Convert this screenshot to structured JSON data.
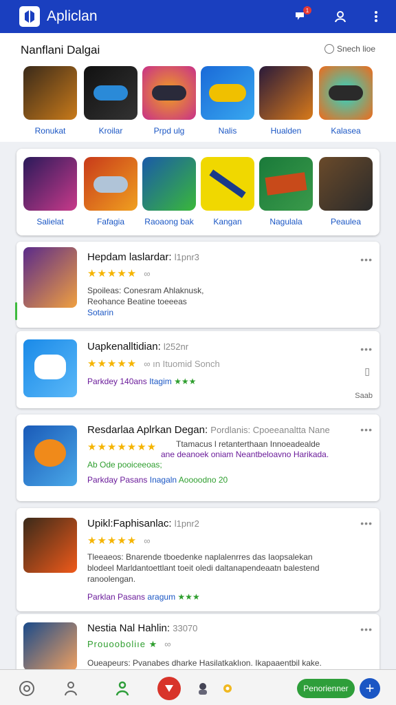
{
  "app": {
    "title": "Aplicl­an",
    "notification_count": "1"
  },
  "section": {
    "title": "Nanflani Dalgai",
    "see_all": "Snech lioe"
  },
  "row1": [
    {
      "label": "Ronukat",
      "icon": "game-art-icon",
      "colors": [
        "#3a2a1a",
        "#c87a1a"
      ]
    },
    {
      "label": "Kroilar",
      "icon": "gamepad-icon",
      "colors": [
        "#111111",
        "#2a8ad8"
      ]
    },
    {
      "label": "Prpd ulg",
      "icon": "gamepad-icon",
      "colors": [
        "#c8308a",
        "#f0a020"
      ]
    },
    {
      "label": "Nalis",
      "icon": "gamepad-icon",
      "colors": [
        "#1a6ad8",
        "#f0c000"
      ]
    },
    {
      "label": "Hualden",
      "icon": "game-art-icon",
      "colors": [
        "#2a1a3a",
        "#d87a1a"
      ]
    },
    {
      "label": "Kalasea",
      "icon": "gamepad-icon",
      "colors": [
        "#f06a1a",
        "#2ad8c8"
      ]
    }
  ],
  "row2": [
    {
      "label": "Salielat",
      "icon": "character-icon",
      "colors": [
        "#2a1a5a",
        "#c83a8a"
      ]
    },
    {
      "label": "Fafagia",
      "icon": "gamepad-icon",
      "colors": [
        "#c83a1a",
        "#f0a020"
      ]
    },
    {
      "label": "Raoaong bak",
      "icon": "character-icon",
      "colors": [
        "#1a5aa8",
        "#3ab83a"
      ]
    },
    {
      "label": "Kangan",
      "icon": "controller-icon",
      "colors": [
        "#f0d800",
        "#1a3a8a"
      ]
    },
    {
      "label": "Nagulala",
      "icon": "game-art-icon",
      "colors": [
        "#1a7a3a",
        "#c84a1a"
      ]
    },
    {
      "label": "Peaulea",
      "icon": "game-art-icon",
      "colors": [
        "#6a4a2a",
        "#2a2a2a"
      ]
    }
  ],
  "cards": [
    {
      "title": "Hepdam laslardar:",
      "meta": "l1pnr3",
      "stars": "★★★★★",
      "link": "∞",
      "lines": [
        "Spoileas: Conesram  Ahlaknusk,",
        "Reohance Beatine toeeeas"
      ],
      "tag": "Sotarin",
      "colors": [
        "#5a2a8a",
        "#f0a040"
      ]
    },
    {
      "title": "Uapkenalltidian:",
      "meta": "l252nr",
      "stars": "★★★★★",
      "link": "∞ ın Ituomid Sonch",
      "lines": [
        "Parkdey 140ans",
        "Itagim",
        "★★★"
      ],
      "side": "Saab",
      "colors": [
        "#1a8ae8",
        "#2a2a2a"
      ]
    },
    {
      "title": "Resdarlaa Aplrkan Degan:",
      "meta": "Pordlanis: Cpoeeanaltta Nane",
      "stars": "★★★★★★★",
      "link": "Ttamacus l retanterthaan Innoeadealde",
      "lines": [
        "ane deanoek oniam Neantbeloavno Harikada.",
        "Ab Ode pooiceeoas;",
        "Parkday Pasans",
        "Inagaln",
        "Aoooodno 20"
      ],
      "colors": [
        "#1a5ab8",
        "#f08a1a"
      ]
    },
    {
      "title": "Upikl:Faphisanlac:",
      "meta": "l1pnr2",
      "stars": "★★★★★",
      "link": "∞",
      "lines": [
        "Tleeaeos: Bnarende tboedenke naplalenrres das Iaopsalekan",
        "blodeel Marldantoettlant toeit oledi daltanapendeaatn balestend",
        "ranoolengan."
      ],
      "extra": [
        "Parklan Pasans",
        "aragum",
        "★★★"
      ],
      "colors": [
        "#3a2a1a",
        "#f05a1a"
      ]
    },
    {
      "title": "Nestia Nal Hahlin:",
      "meta": "33070",
      "stars": "Prouooboliıe ★",
      "link": "∞",
      "lines": [
        "Oueapeurs: Pvanabes dharke Hasilatkaklıon. Ikapaaentbil kake."
      ],
      "colors": [
        "#1a4a8a",
        "#f0a060"
      ]
    }
  ],
  "bottom_nav": {
    "cta": "Penorienner",
    "fab": "+"
  }
}
